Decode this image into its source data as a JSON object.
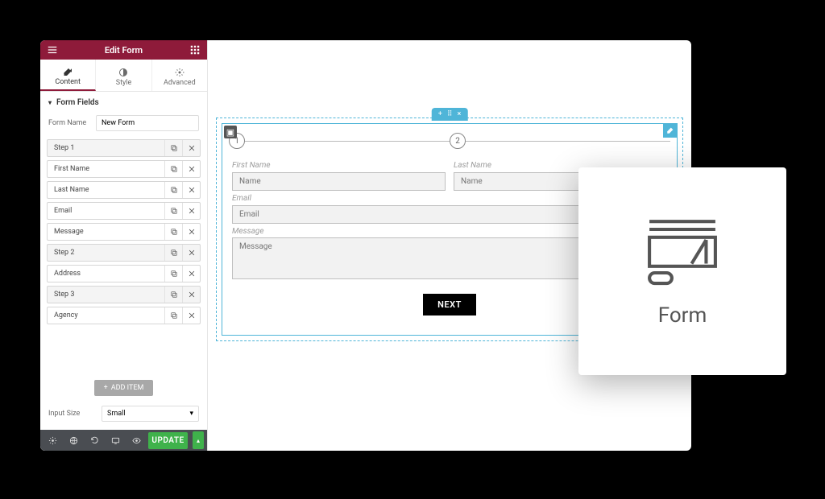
{
  "panel": {
    "title": "Edit Form",
    "tabs": {
      "content": "Content",
      "style": "Style",
      "advanced": "Advanced"
    },
    "section": "Form Fields",
    "form_name_label": "Form Name",
    "form_name_value": "New Form",
    "fields": [
      {
        "label": "Step 1",
        "step": true
      },
      {
        "label": "First Name",
        "step": false
      },
      {
        "label": "Last Name",
        "step": false
      },
      {
        "label": "Email",
        "step": false
      },
      {
        "label": "Message",
        "step": false
      },
      {
        "label": "Step 2",
        "step": true
      },
      {
        "label": "Address",
        "step": false
      },
      {
        "label": "Step 3",
        "step": true
      },
      {
        "label": "Agency",
        "step": false
      }
    ],
    "add_item": "ADD ITEM",
    "input_size_label": "Input Size",
    "input_size_value": "Small",
    "update": "UPDATE"
  },
  "preview": {
    "step_badges": [
      "1",
      "2"
    ],
    "first_name_label": "First Name",
    "first_name_placeholder": "Name",
    "last_name_label": "Last Name",
    "last_name_placeholder": "Name",
    "email_label": "Email",
    "email_placeholder": "Email",
    "message_label": "Message",
    "message_placeholder": "Message",
    "next": "NEXT"
  },
  "card": {
    "caption": "Form"
  }
}
